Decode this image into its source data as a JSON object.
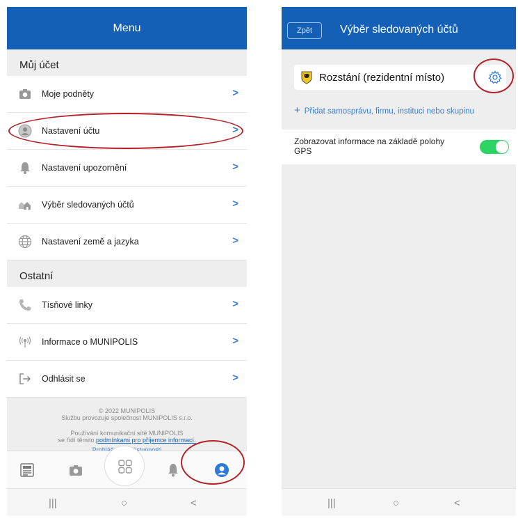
{
  "phone1": {
    "header": {
      "title": "Menu"
    },
    "sections": [
      {
        "title": "Můj účet",
        "items": [
          {
            "label": "Moje podněty",
            "icon": "camera-icon"
          },
          {
            "label": "Nastavení účtu",
            "icon": "user-icon"
          },
          {
            "label": "Nastavení upozornění",
            "icon": "bell-icon"
          },
          {
            "label": "Výběr sledovaných účtů",
            "icon": "houses-icon"
          },
          {
            "label": "Nastavení země a jazyka",
            "icon": "globe-icon"
          }
        ]
      },
      {
        "title": "Ostatní",
        "items": [
          {
            "label": "Tísňové linky",
            "icon": "phone-icon"
          },
          {
            "label": "Informace o MUNIPOLIS",
            "icon": "antenna-icon"
          },
          {
            "label": "Odhlásit se",
            "icon": "logout-icon"
          }
        ]
      }
    ],
    "chevron": ">",
    "footer": {
      "copyright": "© 2022 MUNIPOLIS",
      "operator": "Službu provozuje společnost MUNIPOLIS s.r.o.",
      "usage_line": "Používání komunikační sítě MUNIPOLIS",
      "terms_prefix": "se řídí těmito ",
      "terms_link": "podmínkami pro příjemce informací.",
      "truncated": "Prohlášení o přístupnosti"
    },
    "tabbar": [
      "news-icon",
      "camera-icon",
      "grid-icon",
      "bell-icon",
      "profile-icon"
    ],
    "sysnav": {
      "recent": "|||",
      "home": "○",
      "back": "<"
    }
  },
  "phone2": {
    "header": {
      "back_label": "Zpět",
      "title": "Výběr sledovaných účtů"
    },
    "account": {
      "name": "Rozstání (rezidentní místo)"
    },
    "add_link": {
      "plus": "+",
      "label": "Přidat samosprávu, firmu, instituci nebo skupinu"
    },
    "gps": {
      "label": "Zobrazovat informace na základě polohy GPS",
      "enabled": true
    },
    "sysnav": {
      "recent": "|||",
      "home": "○",
      "back": "<"
    }
  },
  "colors": {
    "brand": "#1460b7",
    "accent": "#3b7fd6",
    "toggle_on": "#2bd463",
    "annotation": "#b3222a"
  }
}
